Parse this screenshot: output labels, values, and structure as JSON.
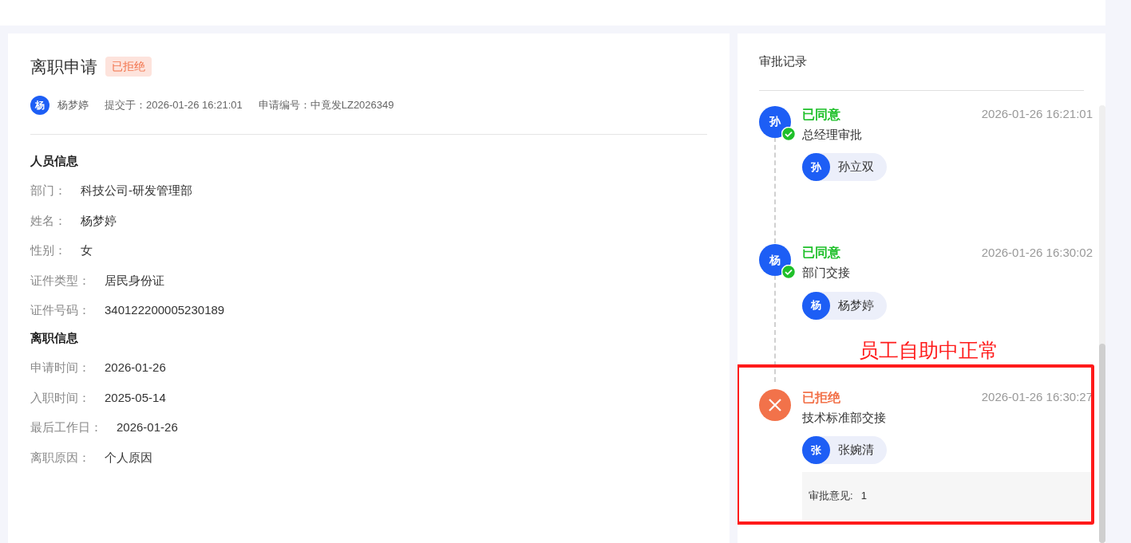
{
  "application": {
    "title": "离职申请",
    "status": {
      "label": "已拒绝",
      "kind": "rejected"
    },
    "applicant": {
      "avatar": "杨",
      "name": "杨梦婷"
    },
    "submitted": "提交于：2026-01-26 16:21:01",
    "number": "申请编号：中竟发LZ2026349"
  },
  "sections": [
    {
      "title": "人员信息",
      "fields": [
        {
          "label": "部门：",
          "value": "科技公司-研发管理部"
        },
        {
          "label": "姓名：",
          "value": "杨梦婷"
        },
        {
          "label": "性别：",
          "value": "女"
        },
        {
          "label": "证件类型：",
          "value": "居民身份证"
        },
        {
          "label": "证件号码：",
          "value": "340122200005230189"
        }
      ]
    },
    {
      "title": "离职信息",
      "fields": [
        {
          "label": "申请时间：",
          "value": "2026-01-26"
        },
        {
          "label": "入职时间：",
          "value": "2025-05-14"
        },
        {
          "label": "最后工作日：",
          "value": "2026-01-26"
        },
        {
          "label": "离职原因：",
          "value": "个人原因"
        }
      ]
    }
  ],
  "approval": {
    "title": "审批记录",
    "records": [
      {
        "avatar": "孙",
        "status": "已同意",
        "kind": "approved",
        "time": "2026-01-26 16:21:01",
        "step": "总经理审批",
        "approver": {
          "avatar": "孙",
          "name": "孙立双"
        }
      },
      {
        "avatar": "杨",
        "status": "已同意",
        "kind": "approved",
        "time": "2026-01-26 16:30:02",
        "step": "部门交接",
        "approver": {
          "avatar": "杨",
          "name": "杨梦婷"
        }
      },
      {
        "status": "已拒绝",
        "kind": "rejected",
        "time": "2026-01-26 16:30:27",
        "step": "技术标准部交接",
        "approver": {
          "avatar": "张",
          "name": "张婉清"
        },
        "comment": {
          "label": "审批意见:",
          "value": "1"
        },
        "highlighted": true
      }
    ]
  },
  "annotation": {
    "text": "员工自助中正常"
  }
}
